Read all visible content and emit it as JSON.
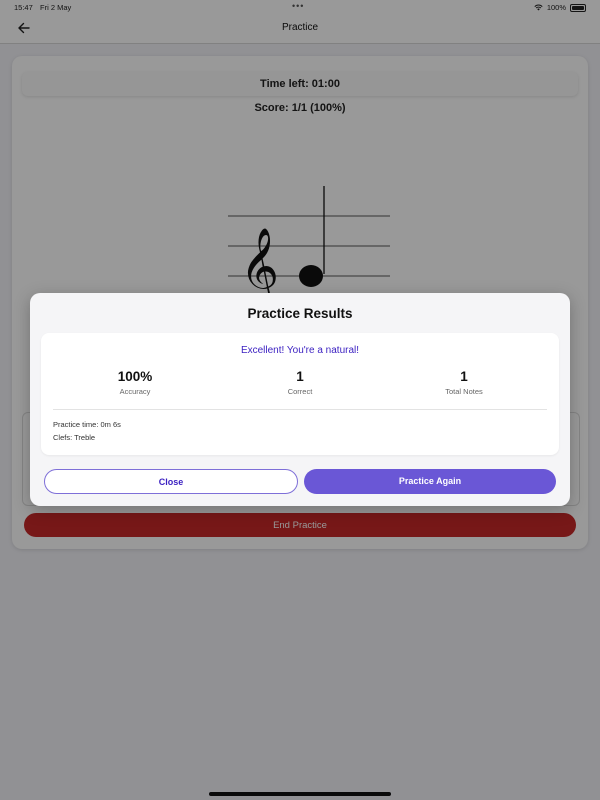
{
  "status_bar": {
    "time": "15:47",
    "date": "Fri 2 May",
    "dots": "•••",
    "battery": "100%"
  },
  "nav": {
    "title": "Practice",
    "back_icon": "arrow-left-icon"
  },
  "practice": {
    "time_left": "Time left: 01:00",
    "score": "Score: 1/1 (100%)",
    "clef": "treble",
    "end_button_label": "End Practice"
  },
  "modal": {
    "title": "Practice Results",
    "message": "Excellent! You're a natural!",
    "stats": [
      {
        "value": "100%",
        "label": "Accuracy"
      },
      {
        "value": "1",
        "label": "Correct"
      },
      {
        "value": "1",
        "label": "Total Notes"
      }
    ],
    "details": {
      "practice_time": "Practice time: 0m 6s",
      "clefs": "Clefs: Treble"
    },
    "buttons": {
      "close_label": "Close",
      "again_label": "Practice Again"
    }
  },
  "colors": {
    "accent": "#6a57d6",
    "accent_text": "#3a1fc1",
    "danger": "#c62828"
  }
}
